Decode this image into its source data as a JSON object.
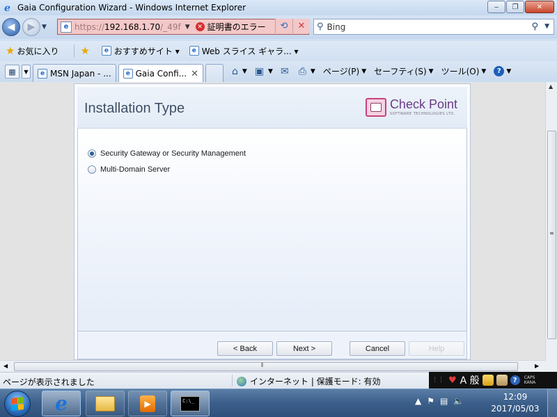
{
  "window": {
    "title": "Gaia Configuration Wizard - Windows Internet Explorer",
    "minimize": "‒",
    "maximize": "❐",
    "close": "✕"
  },
  "address": {
    "url_prefix": "https://",
    "url_host": "192.168.1.70",
    "url_rest": "/_49f",
    "cert_error": "証明書のエラー",
    "search_placeholder": "Bing"
  },
  "favorites": {
    "label": "お気に入り",
    "items": [
      "おすすめサイト ▾",
      "Web スライス ギャラ... ▾"
    ]
  },
  "tabs": [
    {
      "label": "MSN Japan - ..."
    },
    {
      "label": "Gaia Confi...",
      "close": "✕"
    }
  ],
  "commandbar": {
    "page": "ページ(P)",
    "safety": "セーフティ(S)",
    "tools": "ツール(O)"
  },
  "wizard": {
    "title": "Installation Type",
    "logo": {
      "name": "Check Point",
      "sub": "SOFTWARE TECHNOLOGIES LTD."
    },
    "options": [
      {
        "label": "Security Gateway or Security Management",
        "checked": true
      },
      {
        "label": "Multi-Domain Server",
        "checked": false
      }
    ],
    "buttons": {
      "back": "< Back",
      "next": "Next >",
      "cancel": "Cancel",
      "help": "Help"
    }
  },
  "statusbar": {
    "text": "ページが表示されました",
    "zone": "インターネット | 保護モード: 有効"
  },
  "langbar": {
    "ime": "A 般",
    "caps": "CAPS",
    "kana": "KANA"
  },
  "taskbar": {
    "time": "12:09",
    "date": "2017/05/03"
  }
}
